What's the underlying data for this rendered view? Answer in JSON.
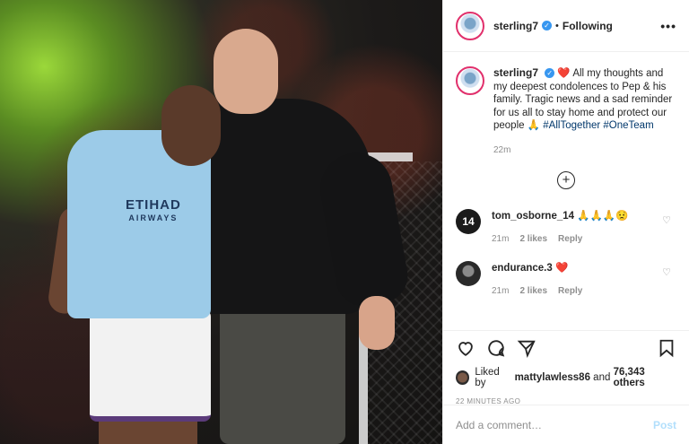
{
  "post": {
    "username": "sterling7",
    "follow_status": "Following",
    "more_icon": "•••",
    "caption": {
      "username": "sterling7",
      "emoji": "❤️",
      "text": "All my thoughts and my deepest condolences to Pep & his family. Tragic news and a sad reminder for us all to stay home and protect our people 🙏",
      "hashtags": [
        "#AllTogether",
        "#OneTeam"
      ],
      "time": "22m"
    },
    "comments": [
      {
        "username": "tom_osborne_14",
        "avatar_text": "14",
        "text": "🙏🙏🙏😟",
        "time": "21m",
        "likes": "2 likes",
        "reply": "Reply"
      },
      {
        "username": "endurance.3",
        "text": "❤️",
        "time": "21m",
        "likes": "2 likes",
        "reply": "Reply"
      }
    ],
    "liked_by": {
      "prefix": "Liked by",
      "user": "mattylawless86",
      "joiner": "and",
      "others": "76,343 others"
    },
    "posted_ago": "22 MINUTES AGO",
    "comment_input": {
      "placeholder": "Add a comment…",
      "post_label": "Post"
    },
    "photo": {
      "sponsor_top": "ETIHAD",
      "sponsor_bottom": "AIRWAYS"
    },
    "colors": {
      "accent": "#3897f0",
      "like_heart": "#ed4956",
      "post_disabled": "#b2dffc",
      "link": "#00376b"
    }
  }
}
